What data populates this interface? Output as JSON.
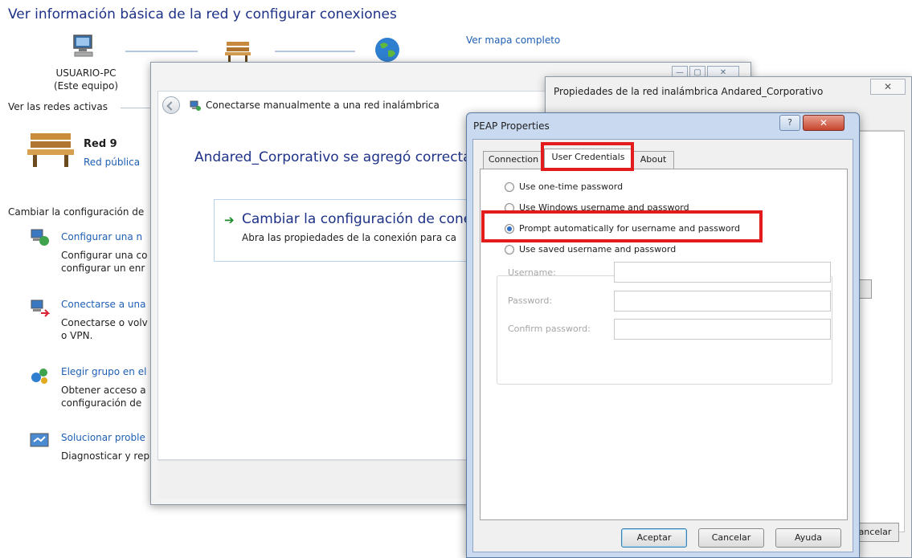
{
  "page": {
    "title": "Ver información básica de la red y configurar conexiones",
    "map_link": "Ver mapa completo",
    "computer": {
      "name": "USUARIO-PC",
      "subtitle": "(Este equipo)"
    },
    "active_networks_label": "Ver las redes activas",
    "network": {
      "name": "Red 9",
      "type": "Red pública"
    },
    "change_settings_label": "Cambiar la configuración de",
    "tasks": [
      {
        "icon": "network-setup-icon",
        "title": "Configurar una n",
        "desc_lines": [
          "Configurar una co",
          "configurar un enr"
        ]
      },
      {
        "icon": "network-connect-icon",
        "title": "Conectarse a una",
        "desc_lines": [
          "Conectarse o volv",
          "o VPN."
        ]
      },
      {
        "icon": "homegroup-icon",
        "title": "Elegir grupo en el",
        "desc_lines": [
          "Obtener acceso a",
          "configuración de"
        ]
      },
      {
        "icon": "troubleshoot-icon",
        "title": "Solucionar proble",
        "desc_lines": [
          "Diagnosticar y rep"
        ]
      }
    ]
  },
  "wizard": {
    "title": "Conectarse manualmente a una red inalámbrica",
    "heading": "Andared_Corporativo se agregó correcta",
    "option_title": "Cambiar la configuración de cone",
    "option_desc": "Abra las propiedades de la conexión para ca",
    "controls": [
      "—",
      "▢",
      "✕"
    ]
  },
  "properties": {
    "title": "Propiedades de la red inalámbrica Andared_Corporativo",
    "close_label": "✕",
    "cancel_label": "ancelar"
  },
  "peap": {
    "title": "PEAP Properties",
    "help_label": "?",
    "close_label": "✕",
    "tabs": [
      "Connection",
      "User Credentials",
      "About"
    ],
    "active_tab": "User Credentials",
    "options": [
      {
        "label": "Use one-time password",
        "checked": false
      },
      {
        "label": "Use Windows username and password",
        "checked": false
      },
      {
        "label": "Prompt automatically for username and password",
        "checked": true
      },
      {
        "label": "Use saved username and password",
        "checked": false
      }
    ],
    "fields": [
      {
        "label": "Username:",
        "value": ""
      },
      {
        "label": "Password:",
        "value": ""
      },
      {
        "label": "Confirm password:",
        "value": ""
      }
    ],
    "buttons": {
      "ok": "Aceptar",
      "cancel": "Cancelar",
      "help": "Ayuda"
    }
  },
  "colors": {
    "link": "#1e5fb4",
    "heading": "#1e3287",
    "highlight": "#e31b1b",
    "radio_checked": "#2e6fc7"
  }
}
